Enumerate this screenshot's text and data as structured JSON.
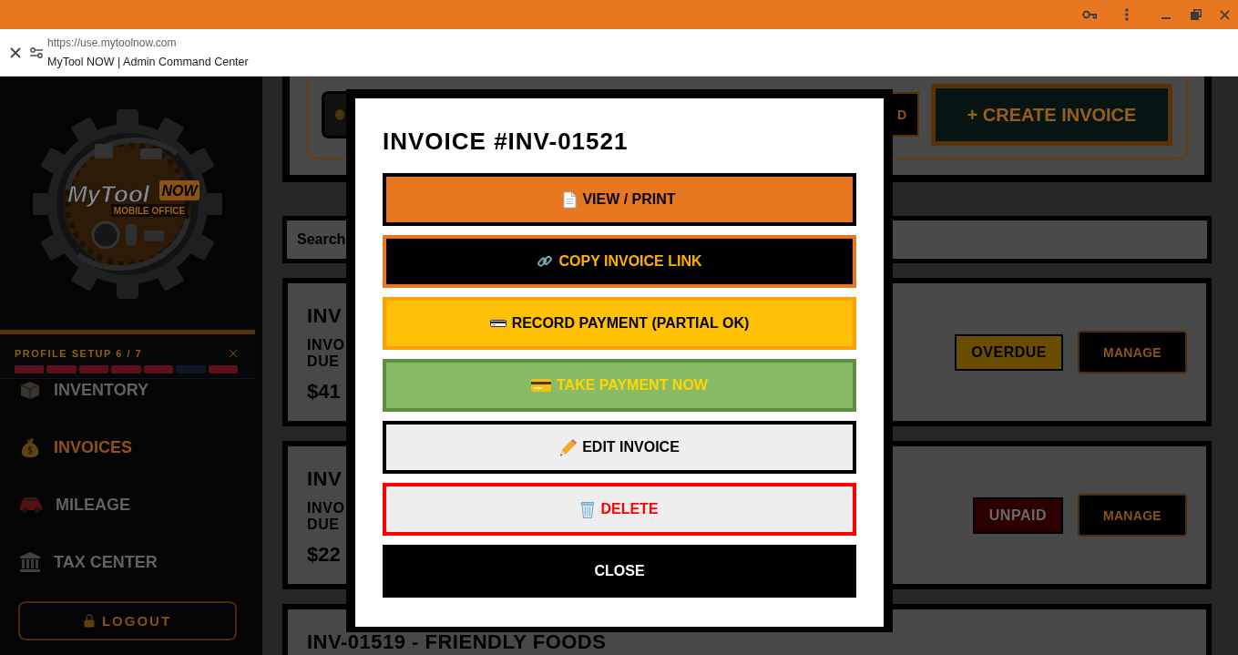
{
  "browser": {
    "url": "https://use.mytoolnow.com",
    "page_title": "MyTool NOW | Admin Command Center"
  },
  "sidebar": {
    "logo": {
      "name": "MyTool",
      "badge": "NOW",
      "tagline": "MOBILE OFFICE"
    },
    "setup": {
      "title": "PROFILE SETUP 6 / 7",
      "steps": [
        {
          "done": true
        },
        {
          "done": true
        },
        {
          "done": true
        },
        {
          "done": true
        },
        {
          "done": true
        },
        {
          "done": false
        },
        {
          "done": true
        }
      ]
    },
    "nav": [
      {
        "label": "INVENTORY",
        "selected": false
      },
      {
        "label": "INVOICES",
        "selected": true
      },
      {
        "label": "MILEAGE",
        "selected": false
      },
      {
        "label": "TAX CENTER",
        "selected": false
      }
    ],
    "logout": "LOGOUT"
  },
  "toolbar": {
    "button_2": "D",
    "create_button": "+ CREATE INVOICE"
  },
  "search": {
    "placeholder": "Search"
  },
  "invoices": [
    {
      "title": "INV",
      "subtitle_lines": [
        "INVO",
        "DUE"
      ],
      "amount": "$41",
      "status": {
        "kind": "overdue",
        "label": "OVERDUE"
      },
      "action": "MANAGE"
    },
    {
      "title": "INV",
      "subtitle_lines": [
        "INVO",
        "DUE"
      ],
      "amount": "$22",
      "status": {
        "kind": "unpaid",
        "label": "UNPAID"
      },
      "action": "MANAGE"
    },
    {
      "title": "INV-01519 - FRIENDLY FOODS"
    }
  ],
  "modal": {
    "title": "INVOICE #INV-01521",
    "actions": [
      {
        "kind": "view",
        "label": "VIEW / PRINT"
      },
      {
        "kind": "copy",
        "label": "COPY INVOICE LINK"
      },
      {
        "kind": "record",
        "label": "RECORD PAYMENT (PARTIAL OK)"
      },
      {
        "kind": "take",
        "label": "TAKE PAYMENT NOW"
      },
      {
        "kind": "edit",
        "label": "EDIT INVOICE"
      },
      {
        "kind": "delete",
        "label": "DELETE"
      },
      {
        "kind": "close",
        "label": "CLOSE"
      }
    ]
  }
}
